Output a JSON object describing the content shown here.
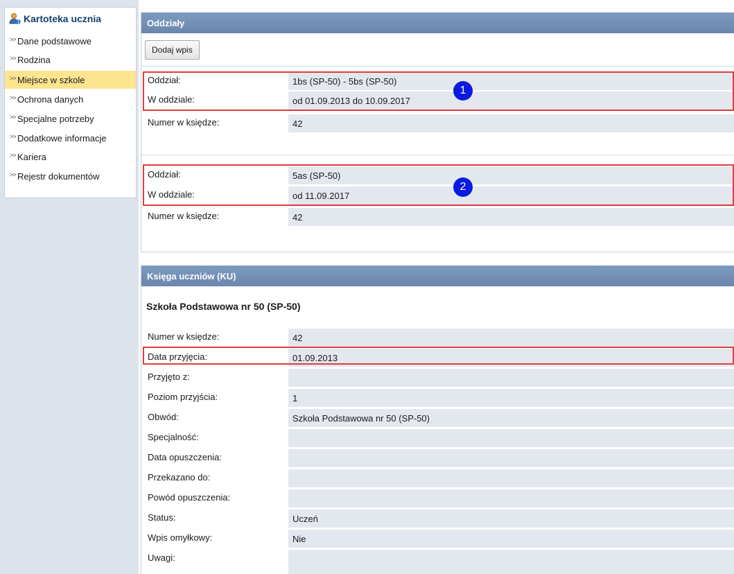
{
  "sidebar": {
    "title": "Kartoteka ucznia",
    "items": [
      {
        "label": "Dane podstawowe"
      },
      {
        "label": "Rodzina"
      },
      {
        "label": "Miejsce w szkole"
      },
      {
        "label": "Ochrona danych"
      },
      {
        "label": "Specjalne potrzeby"
      },
      {
        "label": "Dodatkowe informacje"
      },
      {
        "label": "Kariera"
      },
      {
        "label": "Rejestr dokumentów"
      }
    ]
  },
  "oddzialy": {
    "header": "Oddziały",
    "add_button": "Dodaj wpis",
    "entries": [
      {
        "marker": "1",
        "rows": [
          {
            "label": "Oddział:",
            "value": "1bs (SP-50) - 5bs (SP-50)"
          },
          {
            "label": "W oddziale:",
            "value": "od 01.09.2013 do 10.09.2017"
          },
          {
            "label": "Numer w księdze:",
            "value": "42"
          }
        ]
      },
      {
        "marker": "2",
        "rows": [
          {
            "label": "Oddział:",
            "value": "5as (SP-50)"
          },
          {
            "label": "W oddziale:",
            "value": "od 11.09.2017"
          },
          {
            "label": "Numer w księdze:",
            "value": "42"
          }
        ]
      }
    ]
  },
  "ksiega": {
    "header": "Księga uczniów (KU)",
    "school": "Szkoła Podstawowa nr 50 (SP-50)",
    "rows": [
      {
        "label": "Numer w księdze:",
        "value": "42"
      },
      {
        "label": "Data przyjęcia:",
        "value": "01.09.2013"
      },
      {
        "label": "Przyjęto z:",
        "value": ""
      },
      {
        "label": "Poziom przyjścia:",
        "value": "1"
      },
      {
        "label": "Obwód:",
        "value": "Szkoła Podstawowa nr 50 (SP-50)"
      },
      {
        "label": "Specjalność:",
        "value": ""
      },
      {
        "label": "Data opuszczenia:",
        "value": ""
      },
      {
        "label": "Przekazano do:",
        "value": ""
      },
      {
        "label": "Powód opuszczenia:",
        "value": ""
      },
      {
        "label": "Status:",
        "value": "Uczeń"
      },
      {
        "label": "Wpis omyłkowy:",
        "value": "Nie"
      },
      {
        "label": "Uwagi:",
        "value": ""
      }
    ]
  },
  "colors": {
    "highlight": "#e23b3b",
    "marker": "#0a1ae0",
    "header": "#7390b7",
    "active_item": "#fde48f"
  }
}
